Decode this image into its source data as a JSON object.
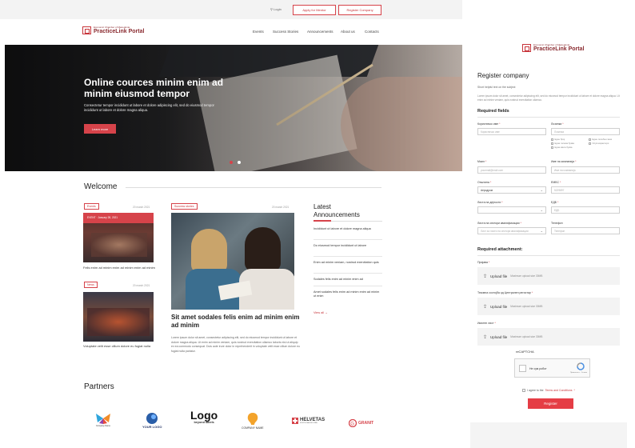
{
  "topbar": {
    "login": "Login",
    "apply": "Apply for Mentor",
    "register": "Register Company"
  },
  "brand": {
    "small": "Economic Chamber of Macedonia",
    "big": "PracticeLink Portal"
  },
  "nav": [
    "Events",
    "Success Stories",
    "Announcements",
    "About us",
    "Contacts"
  ],
  "hero": {
    "title": "Online cources minim enim ad minim eiusmod tempor",
    "text": "Consectetur tempor incididunt ut labore et dolore adipiscing elit, sed do eiusmod tempor incididunt ut labore et dolore magna aliqua.",
    "button": "Learn more"
  },
  "welcome": {
    "title": "Welcome",
    "card1": {
      "tag": "Events",
      "date": "20 march 2021",
      "overlay": "EVENT · January 28, 2021",
      "text": "Felis enim ad minim enim ad minim enim ad minim"
    },
    "card2": {
      "tag": "News",
      "date": "20 march 2021",
      "text": "Voluptate velit esse cillum dolore eu fugiat nulla"
    },
    "featured": {
      "tag": "Success stories",
      "date": "20 march 2021",
      "title": "Sit amet sodales felis enim ad minim enim ad minim",
      "text": "Lorem ipsum dolor sit amet, consectetur adipiscing elit, sed do eiusmod tempor incididunt ut labore et dolore magna aliqua. Ut enim ad minim veniam, quis nostrud exercitation ullamco laboris nisi ut aliquip ex ea commodo consequat. Duis aute irure dolor in reprehenderit in voluptate velit esse cillum dolore eu fugiat nulla pariatur."
    },
    "announcements": {
      "title": "Latest Announcements",
      "items": [
        "Incididunt ut labore et dolore magna aliqua",
        "Do eiusmod tempor incididunt ut labore",
        "Enim ad minim veniam, nostrud exercitation quis",
        "Sodales felis enim ad minim enim ad",
        "Amet sodales felis enim ad minim enim ad minim ut enim"
      ],
      "view_all": "View all"
    }
  },
  "partners": {
    "title": "Partners",
    "items": [
      "Company Name",
      "YOUR LOGO",
      "beyond labels",
      "COMPANY NAME",
      "HELVETAS",
      "GRANIT"
    ],
    "logo_word": "Logo",
    "helvetas_sub": "NORTH MACEDONIA"
  },
  "form": {
    "title": "Register company",
    "subtitle": "Short helpful text on the subject",
    "desc": "Lorem ipsum dolor sit amet, consectetur adipiscing elit, sed do eiusmod tempor incididunt ut labore et dolore magna aliqua. Ut enim ad minim veniam, quis nostrud exercitation ullamco.",
    "required": "Required fields",
    "username_label": "Корисничко име",
    "username_ph": "Корисничко име",
    "password_label": "Лозинка",
    "password_ph": "Лозинка",
    "pw_checks": [
      "Еден број",
      "Една голема буква",
      "Една мала буква",
      "Еден посебен знак",
      "Осум карактери"
    ],
    "email_label": "Маил",
    "email_ph": "yourmail@mail.com",
    "company_label": "Име на компанија",
    "company_ph": "Име на компанија",
    "municipality_label": "Општина",
    "municipality_val": "Аеродром",
    "embs_label": "ЕМБС",
    "embs_ph": "5229897",
    "activity_label": "Листа на дејности",
    "edb_label": "ЕДБ",
    "edb_ph": "ЕДБ",
    "sector_label": "Листа на сектори квалификации",
    "sector_ph": "Лист за листи на сектори квалификации",
    "phone_label": "Телефон",
    "phone_ph": "Телефон",
    "attachment_title": "Required attachment:",
    "attach1": "Пријава",
    "attach2": "Тековна состојба од Централен регистар",
    "attach3": "Имотен лист",
    "upload_label": "Upload file",
    "upload_hint": "Maximum upload size 30MB",
    "recaptcha_title": "reCAPTCHA",
    "recaptcha_text": "Не сум робот",
    "recaptcha_priv": "Приватност - Услови",
    "agree_prefix": "I agree to the",
    "agree_link": "Terms and Conditions",
    "register_btn": "Register"
  },
  "colors": {
    "accent": "#d6434a",
    "brand": "#8a2b30"
  }
}
